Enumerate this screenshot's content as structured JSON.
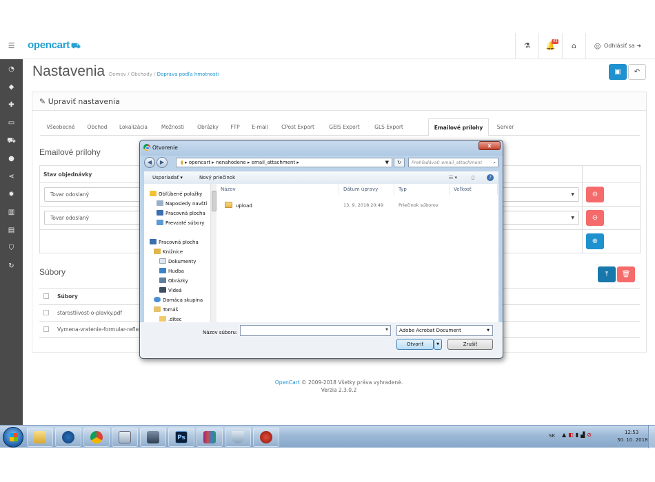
{
  "header": {
    "logo": "opencart",
    "badge_count": "43",
    "logout_label": "Odhlásiť sa"
  },
  "sidebar": {
    "items": [
      "dashboard-icon",
      "tag-icon",
      "puzzle-icon",
      "monitor-icon",
      "cart-icon",
      "user-icon",
      "share-icon",
      "gear-icon",
      "bar-chart-icon",
      "list-icon",
      "shield-icon",
      "sync-icon"
    ]
  },
  "page": {
    "title": "Nastavenia",
    "breadcrumb": [
      "Domov",
      "Obchody",
      "Doprava podľa hmotnosti"
    ]
  },
  "panel": {
    "heading": "Upraviť nastavenia",
    "tabs": [
      "Všeobecné",
      "Obchod",
      "Lokalizácia",
      "Možnosti",
      "Obrázky",
      "FTP",
      "E-mail",
      "CPost Export",
      "GEIS Export",
      "GLS Export",
      "Emailové prílohy",
      "Server"
    ],
    "active_tab": "Emailové prílohy"
  },
  "attachments": {
    "section_title": "Emailové prílohy",
    "column_header": "Stav objednávky",
    "rows": [
      "Tovar odoslaný",
      "Tovar odoslaný"
    ]
  },
  "files": {
    "section_title": "Súbory",
    "column_header": "Súbory",
    "rows": [
      "starostlivost-o-plavky.pdf",
      "Vymena-vratenie-formular-reflex"
    ]
  },
  "footer": {
    "link": "OpenCart",
    "copyright": "© 2009-2018 Všetky práva vyhradené.",
    "version": "Verzia 2.3.0.2"
  },
  "dialog": {
    "title": "Otvorenie",
    "close_label": "x",
    "path": [
      "opencart",
      "nenahodene",
      "email_attachment"
    ],
    "search_placeholder": "Prehľadávať: email_attachment",
    "organize_label": "Usporiadať",
    "new_folder_label": "Nový priečinok",
    "tree": [
      {
        "label": "Obľúbené položky",
        "icon": "star-icon",
        "indent": 0
      },
      {
        "label": "Naposledy navští",
        "icon": "recent-icon",
        "indent": 1
      },
      {
        "label": "Pracovná plocha",
        "icon": "desktop-icon",
        "indent": 1
      },
      {
        "label": "Prevzaté súbory",
        "icon": "downloads-icon",
        "indent": 1
      },
      {
        "label": "Pracovná plocha",
        "icon": "desktop-icon",
        "indent": 0
      },
      {
        "label": "Knižnice",
        "icon": "library-icon",
        "indent": 1
      },
      {
        "label": "Dokumenty",
        "icon": "documents-icon",
        "indent": 2
      },
      {
        "label": "Hudba",
        "icon": "music-icon",
        "indent": 2
      },
      {
        "label": "Obrázky",
        "icon": "pictures-icon",
        "indent": 2
      },
      {
        "label": "Videá",
        "icon": "videos-icon",
        "indent": 2
      },
      {
        "label": "Domáca skupina",
        "icon": "homegroup-icon",
        "indent": 1
      },
      {
        "label": "Tomáš",
        "icon": "user-folder-icon",
        "indent": 1
      },
      {
        "label": ".ditec",
        "icon": "folder-icon",
        "indent": 2
      }
    ],
    "columns": [
      "Názov",
      "Dátum úpravy",
      "Typ",
      "Veľkosť"
    ],
    "file_rows": [
      {
        "name": "upload",
        "date": "13. 9. 2018 20:49",
        "type": "Priečinok súborov",
        "size": ""
      }
    ],
    "filename_label": "Názov súboru:",
    "filename_value": "",
    "filetype": "Adobe Acrobat Document",
    "open_label": "Otvoriť",
    "cancel_label": "Zrušiť"
  },
  "taskbar": {
    "apps": [
      "explorer-icon",
      "thunderbird-icon",
      "chrome-icon",
      "calculator-icon",
      "network-icon",
      "photoshop-icon",
      "winrar-icon",
      "security-icon",
      "game-icon"
    ],
    "photoshop_label": "Ps",
    "lang": "SK",
    "time": "12:53",
    "date": "30. 10. 2018"
  },
  "colors": {
    "accent": "#1e91cf",
    "danger": "#f56b6b",
    "sidebar": "#4a4a4a"
  }
}
